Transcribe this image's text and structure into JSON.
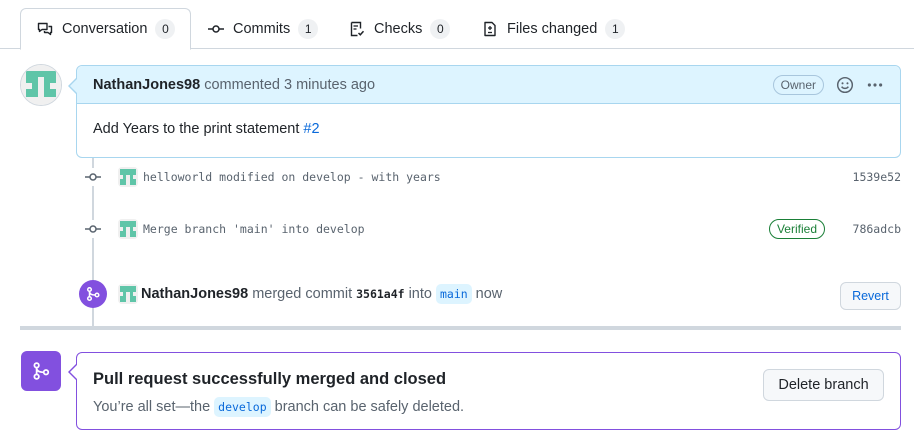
{
  "tabs": [
    {
      "label": "Conversation",
      "count": "0",
      "icon": "comment-discussion-icon"
    },
    {
      "label": "Commits",
      "count": "1",
      "icon": "git-commit-icon"
    },
    {
      "label": "Checks",
      "count": "0",
      "icon": "checklist-icon"
    },
    {
      "label": "Files changed",
      "count": "1",
      "icon": "file-diff-icon"
    }
  ],
  "comment": {
    "author": "NathanJones98",
    "meta": "commented 3 minutes ago",
    "role_badge": "Owner",
    "body_text": "Add Years to the print statement",
    "issue_ref": "#2"
  },
  "commits": [
    {
      "message": "helloworld modified on develop - with years",
      "sha": "1539e52",
      "verified": ""
    },
    {
      "message": "Merge branch 'main' into develop",
      "sha": "786adcb",
      "verified": "Verified"
    }
  ],
  "merge_event": {
    "author": "NathanJones98",
    "action": "merged commit",
    "commit": "3561a4f",
    "into": "into",
    "branch": "main",
    "time": "now",
    "revert_label": "Revert"
  },
  "merged_box": {
    "title": "Pull request successfully merged and closed",
    "sub_before": "You’re all set—the",
    "branch": "develop",
    "sub_after": "branch can be safely deleted.",
    "delete_label": "Delete branch"
  },
  "colors": {
    "accent": "#0969da",
    "merged": "#8250df",
    "verified": "#1a7f37",
    "avatar": "#5fc5a8",
    "comment_header": "#ddf4ff"
  }
}
